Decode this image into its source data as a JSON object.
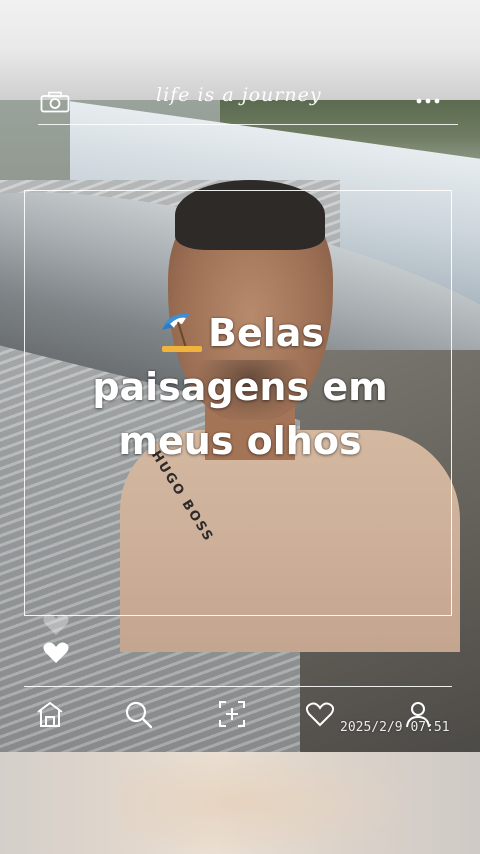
{
  "header": {
    "title": "life is a journey",
    "left_icon": "camera-icon",
    "right_icon": "more-dots-icon"
  },
  "caption": {
    "emoji": "beach-umbrella-emoji",
    "line1": "Belas",
    "line2": "paisagens em",
    "line3": "meus olhos"
  },
  "shirt_print": "HUGO BOSS",
  "side_icons": [
    "heart-icon"
  ],
  "bottom_bar": {
    "icons": [
      "home-icon",
      "search-icon",
      "add-icon",
      "like-icon",
      "profile-icon"
    ]
  },
  "timestamp": "2025/2/9 07:51",
  "colors": {
    "overlay": "#ffffff"
  }
}
